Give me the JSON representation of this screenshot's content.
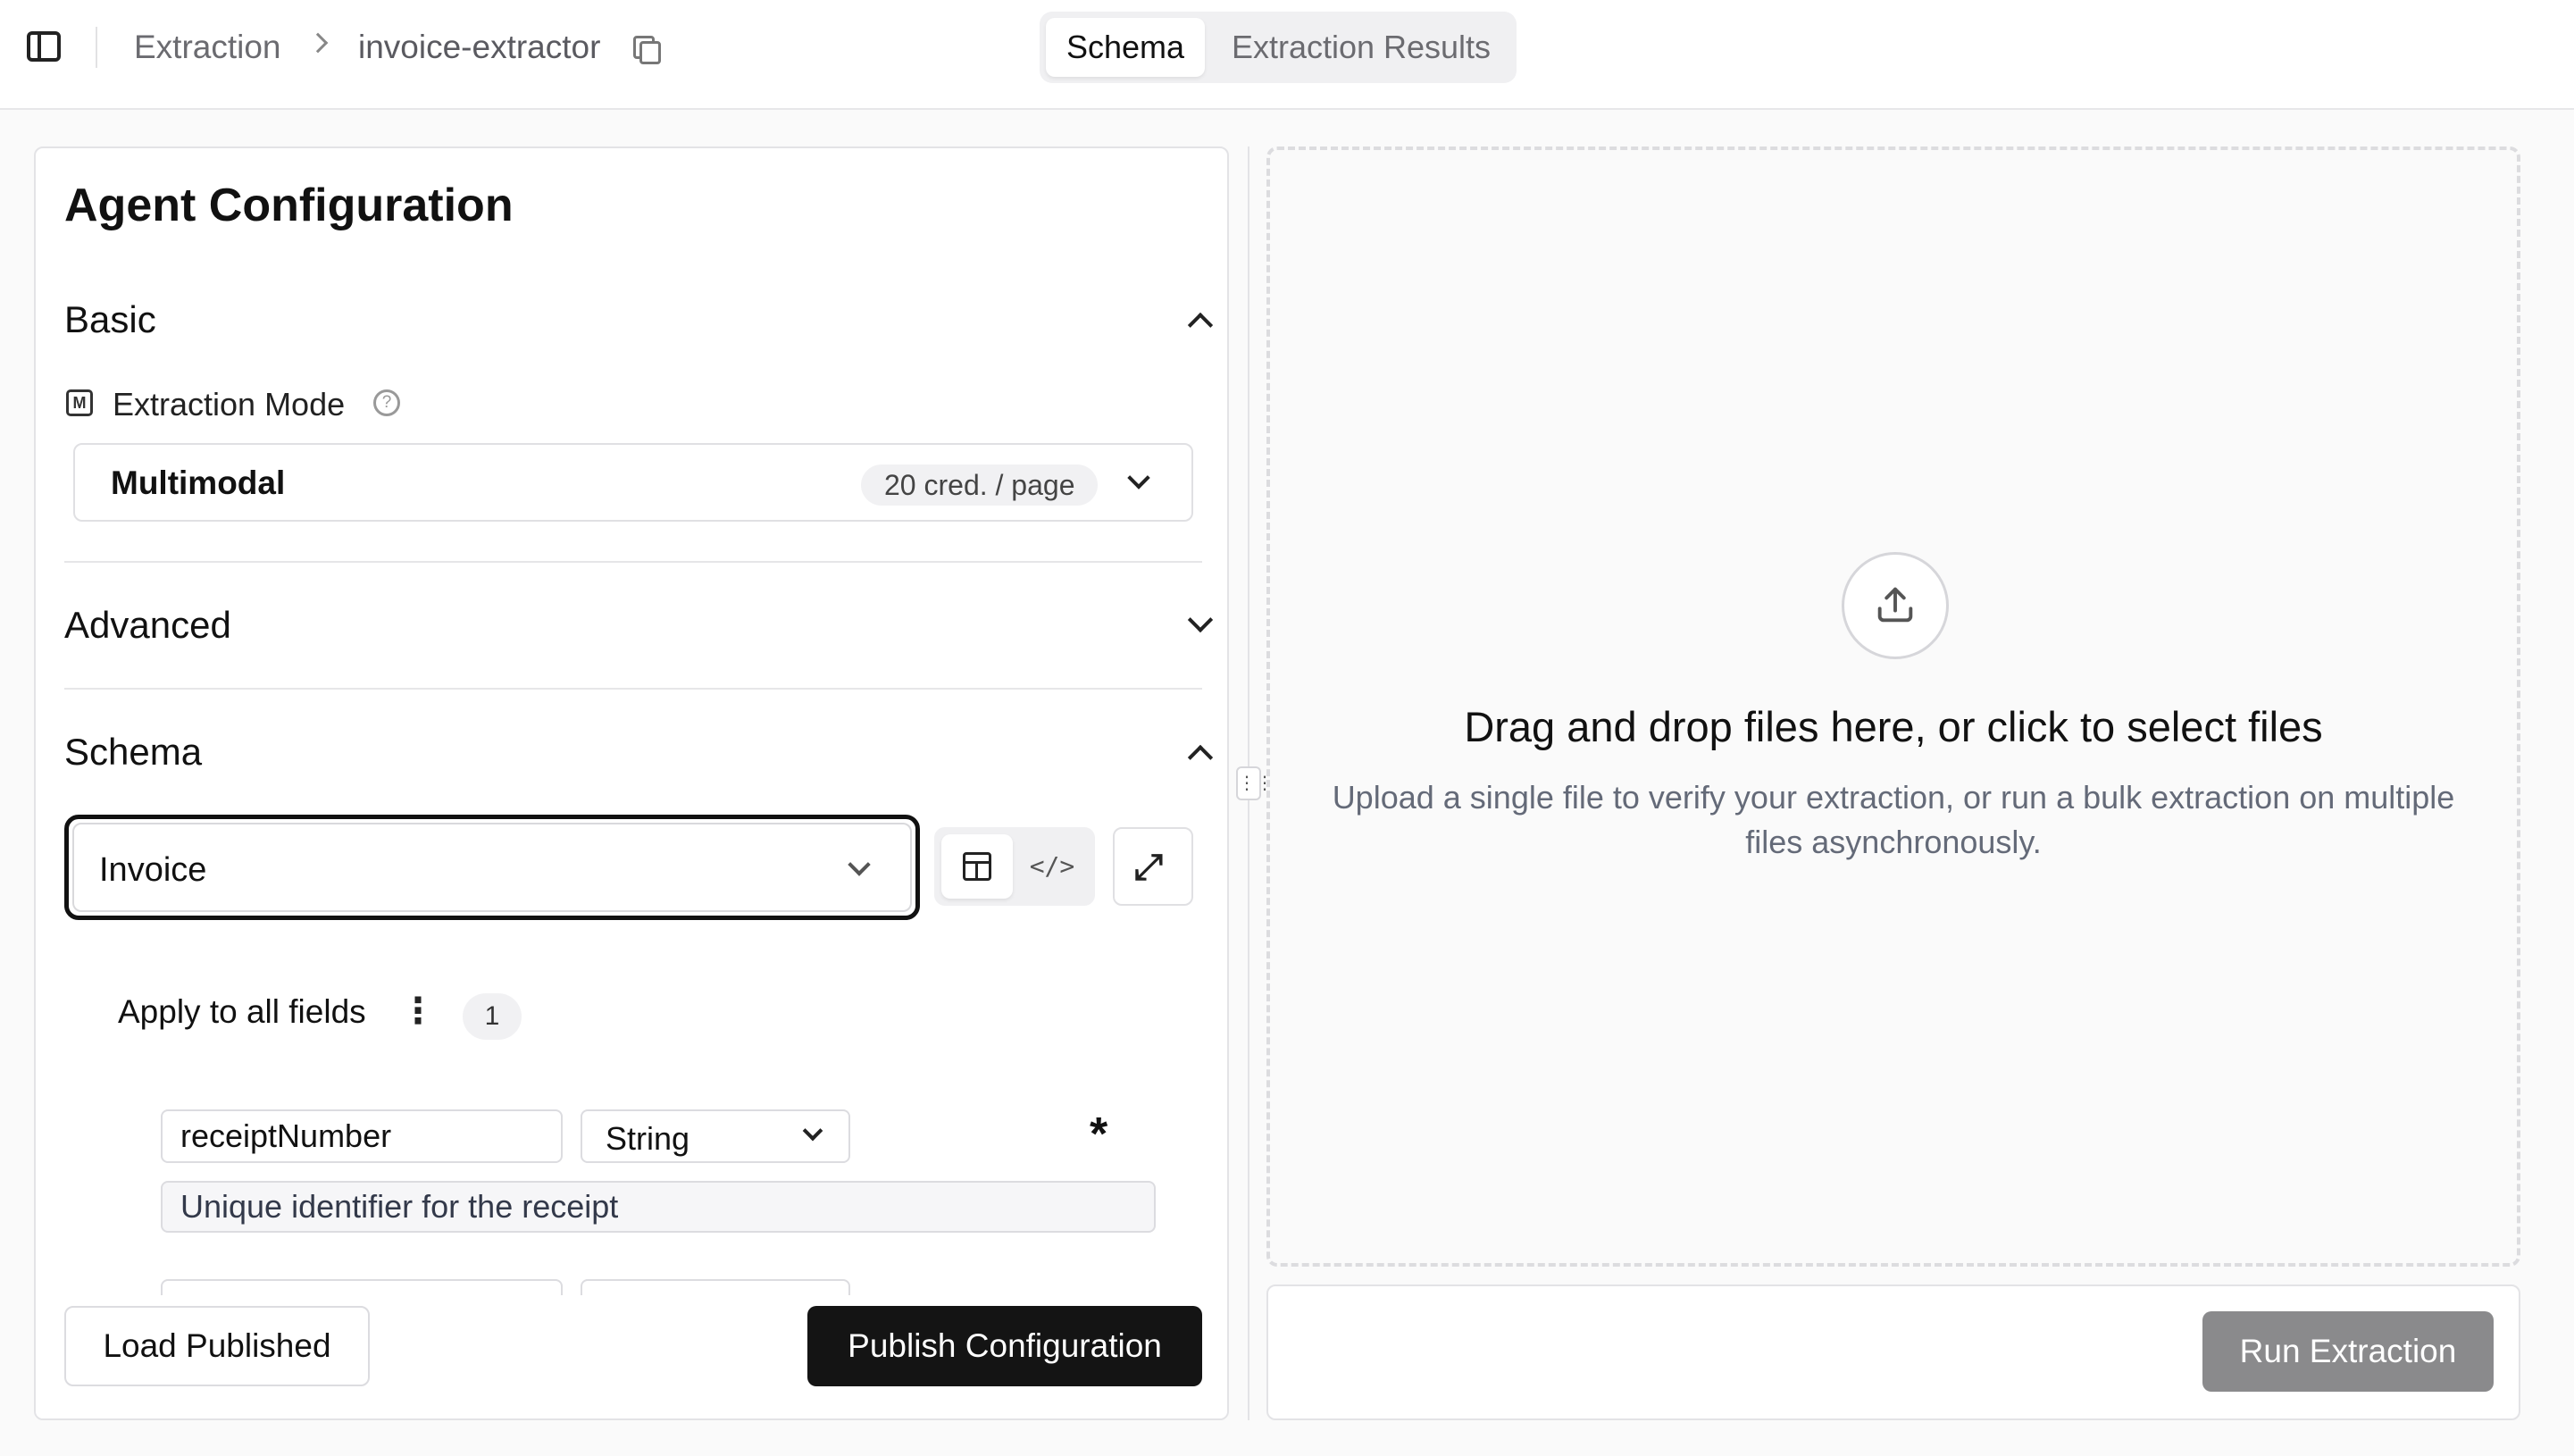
{
  "header": {
    "breadcrumb": [
      "Extraction",
      "invoice-extractor"
    ],
    "tabs": [
      {
        "label": "Schema",
        "active": true
      },
      {
        "label": "Extraction Results",
        "active": false
      }
    ]
  },
  "config": {
    "title": "Agent Configuration",
    "sections": {
      "basic": {
        "title": "Basic",
        "expanded": true
      },
      "advanced": {
        "title": "Advanced",
        "expanded": false
      },
      "schema": {
        "title": "Schema",
        "expanded": true
      }
    },
    "extraction_mode": {
      "label": "Extraction Mode",
      "value": "Multimodal",
      "cost": "20 cred. / page"
    },
    "schema_select": {
      "value": "Invoice"
    },
    "apply_all": {
      "label": "Apply to all fields",
      "count": "1"
    },
    "fields": [
      {
        "name": "receiptNumber",
        "type": "String",
        "required": "*",
        "description": "Unique identifier for the receipt"
      }
    ],
    "buttons": {
      "load": "Load Published",
      "publish": "Publish Configuration"
    }
  },
  "dropzone": {
    "title": "Drag and drop files here, or click to select files",
    "subtitle": "Upload a single file to verify your extraction, or run a bulk extraction on multiple files asynchronously."
  },
  "run_button": "Run Extraction",
  "icons": [
    "sidebar-toggle-icon",
    "copy-icon",
    "chevron-up-icon",
    "chevron-down-icon",
    "help-icon",
    "table-view-icon",
    "code-view-icon",
    "expand-icon",
    "more-vertical-icon",
    "upload-icon"
  ],
  "colors": {
    "primary_button": "#141414",
    "disabled_button": "#8a8a8c",
    "active_tab": "#ffffff"
  }
}
